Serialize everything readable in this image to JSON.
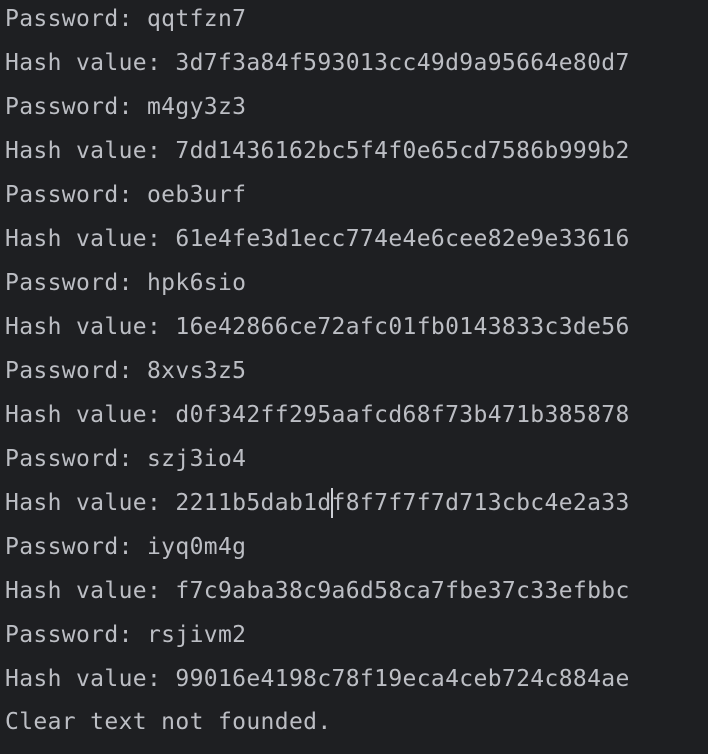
{
  "console": {
    "lines": [
      "Password: qqtfzn7",
      "Hash value: 3d7f3a84f593013cc49d9a95664e80d7",
      "Password: m4gy3z3",
      "Hash value: 7dd1436162bc5f4f0e65cd7586b999b2",
      "Password: oeb3urf",
      "Hash value: 61e4fe3d1ecc774e4e6cee82e9e33616",
      "Password: hpk6sio",
      "Hash value: 16e42866ce72afc01fb0143833c3de56",
      "Password: 8xvs3z5",
      "Hash value: d0f342ff295aafcd68f73b471b385878",
      "Password: szj3io4",
      "Hash value: 2211b5dab1df8f7f7f7d713cbc4e2a33",
      "Password: iyq0m4g",
      "Hash value: f7c9aba38c9a6d58ca7fbe37c33efbbc",
      "Password: rsjivm2",
      "Hash value: 99016e4198c78f19eca4ceb724c884ae",
      "Clear text not founded."
    ]
  },
  "colors": {
    "background": "#1e1f22",
    "text": "#bcbec4",
    "caret": "#ced0d6"
  }
}
